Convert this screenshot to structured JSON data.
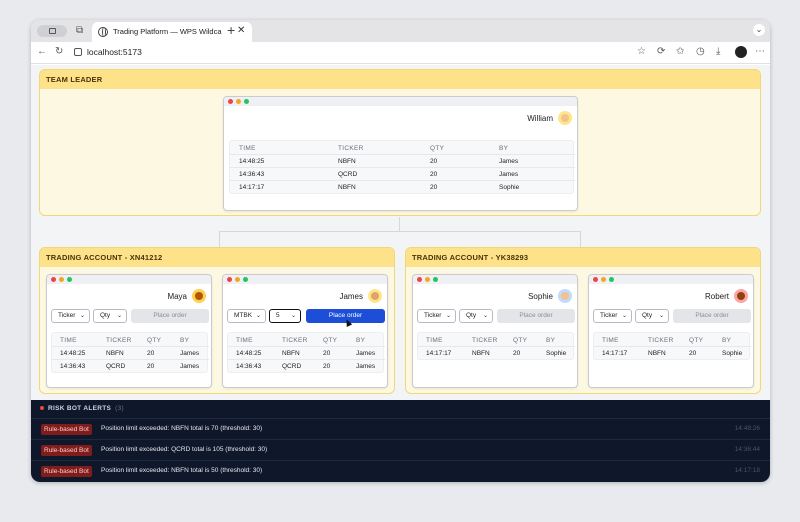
{
  "browser": {
    "tab_title": "Trading Platform — WPS Wildca",
    "url": "localhost:5173"
  },
  "team_leader": {
    "header": "TEAM LEADER",
    "name": "William",
    "columns": [
      "TIME",
      "TICKER",
      "QTY",
      "BY"
    ],
    "rows": [
      [
        "14:48:25",
        "NBFN",
        "20",
        "James"
      ],
      [
        "14:36:43",
        "QCRD",
        "20",
        "James"
      ],
      [
        "14:17:17",
        "NBFN",
        "20",
        "Sophie"
      ]
    ]
  },
  "accounts": [
    {
      "header": "TRADING ACCOUNT - XN41212",
      "traders": [
        {
          "name": "Maya",
          "ticker": "Ticker",
          "qty": "Qty",
          "button": "Place order",
          "rows": [
            [
              "14:48:25",
              "NBFN",
              "20",
              "James"
            ],
            [
              "14:36:43",
              "QCRD",
              "20",
              "James"
            ]
          ]
        },
        {
          "name": "James",
          "ticker": "MTBK",
          "qty": "5",
          "button": "Place order",
          "rows": [
            [
              "14:48:25",
              "NBFN",
              "20",
              "James"
            ],
            [
              "14:36:43",
              "QCRD",
              "20",
              "James"
            ]
          ]
        }
      ]
    },
    {
      "header": "TRADING ACCOUNT - YK38293",
      "traders": [
        {
          "name": "Sophie",
          "ticker": "Ticker",
          "qty": "Qty",
          "button": "Place order",
          "rows": [
            [
              "14:17:17",
              "NBFN",
              "20",
              "Sophie"
            ]
          ]
        },
        {
          "name": "Robert",
          "ticker": "Ticker",
          "qty": "Qty",
          "button": "Place order",
          "rows": [
            [
              "14:17:17",
              "NBFN",
              "20",
              "Sophie"
            ]
          ]
        }
      ]
    }
  ],
  "columns": [
    "TIME",
    "TICKER",
    "QTY",
    "BY"
  ],
  "alerts": {
    "header": "RISK BOT ALERTS",
    "count": "(3)",
    "items": [
      {
        "badge": "Rule-based Bot",
        "message": "Position limit exceeded: NBFN total is 70 (threshold: 30)",
        "time": "14:48:26"
      },
      {
        "badge": "Rule-based Bot",
        "message": "Position limit exceeded: QCRD total is 105 (threshold: 30)",
        "time": "14:36:44"
      },
      {
        "badge": "Rule-based Bot",
        "message": "Position limit exceeded: NBFN total is 50 (threshold: 30)",
        "time": "14:17:18"
      }
    ]
  }
}
